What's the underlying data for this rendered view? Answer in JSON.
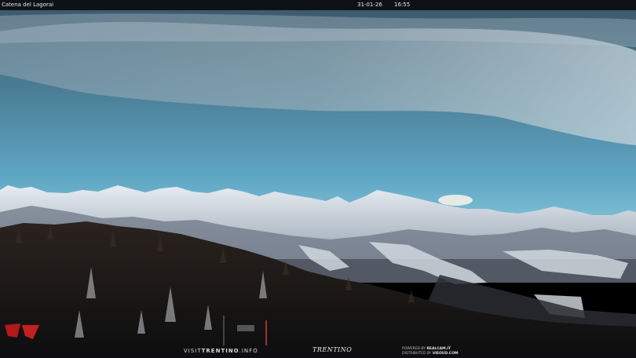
{
  "header": {
    "location": "Catena del Lagorai",
    "date": "31-01-26",
    "time": "16:55"
  },
  "footer": {
    "brand_left_pre": "VISIT",
    "brand_left_bold": "TRENTINO",
    "brand_left_post": ".INFO",
    "brand_center": "TRENTINO",
    "credit_powered_label": "POWERED BY",
    "credit_powered_value": "REALCAM.IT",
    "credit_distributed_label": "DISTRIBUTED BY",
    "credit_distributed_value": "VIEOUD.COM"
  },
  "colors": {
    "sky_top": "#3f5a70",
    "sky_horizon": "#6fb7d2",
    "snow": "#dfe6ee",
    "forest": "#151516",
    "flag": "#b11a1a"
  }
}
